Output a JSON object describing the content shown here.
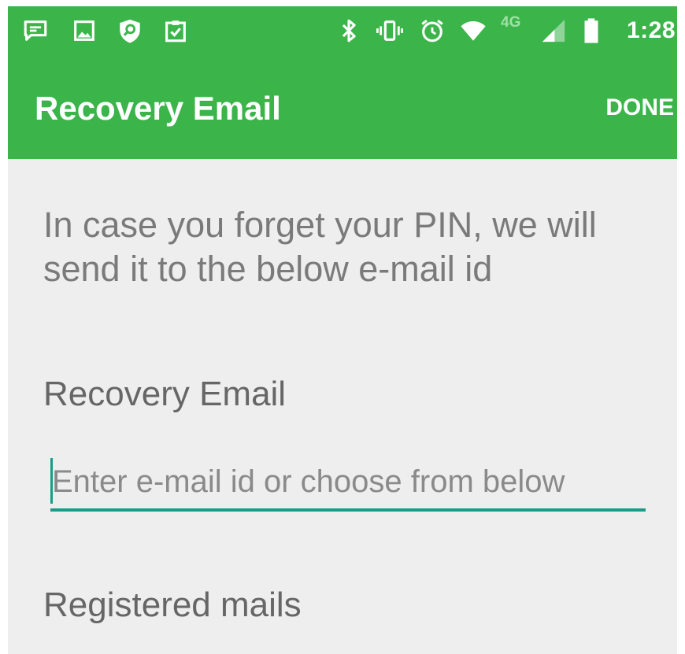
{
  "status_bar": {
    "time": "1:28",
    "network_label": "4G",
    "icons": [
      "chat-notification-icon",
      "image-notification-icon",
      "shield-search-icon",
      "clipboard-check-icon",
      "bluetooth-icon",
      "vibrate-icon",
      "alarm-icon",
      "wifi-icon",
      "cellular-signal-icon",
      "battery-icon"
    ]
  },
  "app_bar": {
    "title": "Recovery Email",
    "action_label": "DONE",
    "background_color": "#3bb54a"
  },
  "main": {
    "intro_text": "In case you forget your PIN, we will send it to the below e-mail id",
    "recovery_email": {
      "label": "Recovery Email",
      "value": "",
      "placeholder": "Enter e-mail id or choose from below",
      "accent_color": "#1a9b8a"
    },
    "registered_mails": {
      "label": "Registered mails"
    }
  }
}
